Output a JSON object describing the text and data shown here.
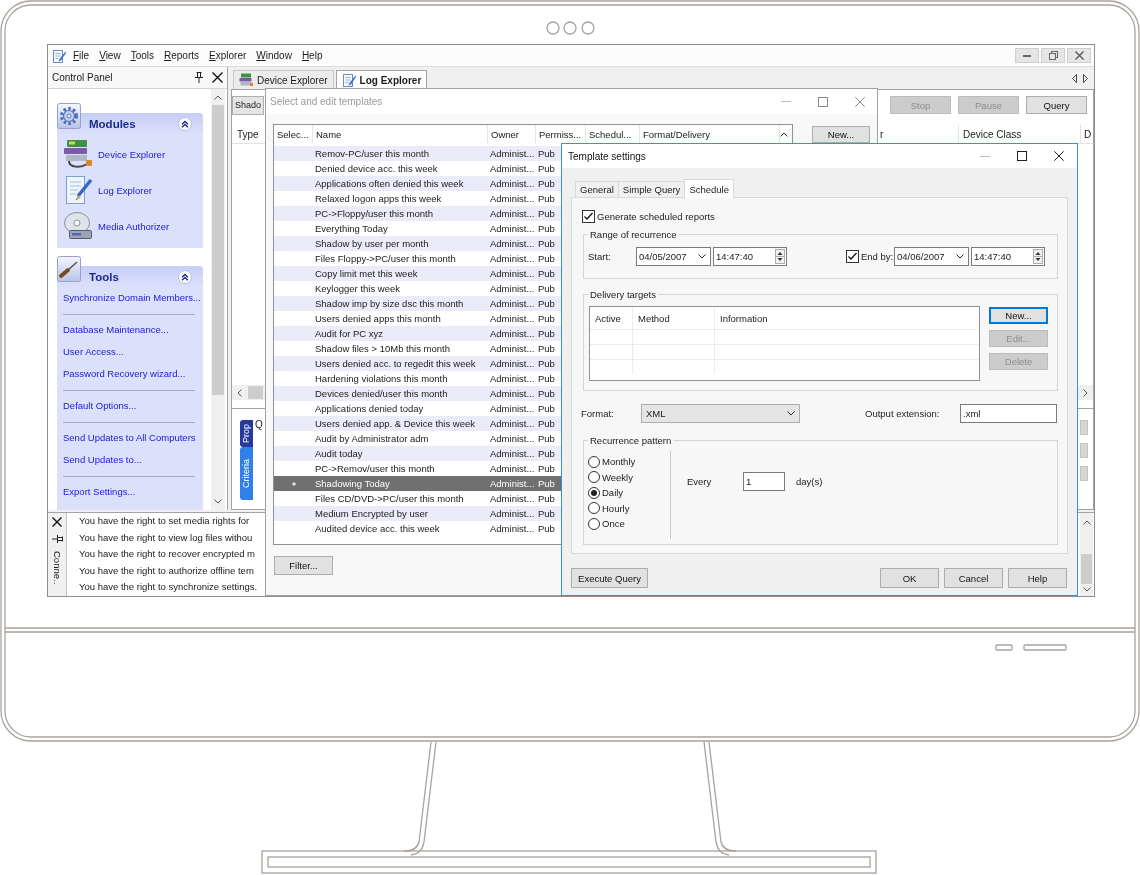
{
  "menu_bar": [
    "File",
    "View",
    "Tools",
    "Reports",
    "Explorer",
    "Window",
    "Help"
  ],
  "control_panel": {
    "title": "Control Panel",
    "groups": [
      {
        "title": "Modules",
        "expanded": true,
        "kind": "icons",
        "items": [
          "Device Explorer",
          "Log Explorer",
          "Media Authorizer"
        ]
      },
      {
        "title": "Tools",
        "expanded": true,
        "kind": "links",
        "sections": [
          [
            "Synchronize Domain Members..."
          ],
          [
            "Database Maintenance...",
            "User Access...",
            "Password Recovery wizard..."
          ],
          [
            "Default Options..."
          ],
          [
            "Send Updates to All Computers",
            "Send Updates to..."
          ],
          [
            "Export Settings..."
          ]
        ]
      }
    ]
  },
  "tabs": [
    {
      "label": "Device Explorer",
      "selected": false
    },
    {
      "label": "Log Explorer",
      "selected": true
    }
  ],
  "log_explorer": {
    "filter_value": "Shado",
    "buttons": [
      {
        "label": "Stop",
        "disabled": true
      },
      {
        "label": "Pause",
        "disabled": true
      },
      {
        "label": "Query",
        "disabled": false
      }
    ],
    "columns": [
      "Type",
      "r",
      "Device Class",
      "D"
    ],
    "side_tabs": [
      {
        "label": "Prop",
        "selected": false
      },
      {
        "label": "Criteria",
        "selected": true
      }
    ],
    "panel_heading": "Q"
  },
  "output_panel": {
    "title": "Conne..",
    "messages": [
      "You have the right to set media rights for",
      "You have the right to view log files withou",
      "You have the right to recover encrypted m",
      "You have the right to authorize offline tem",
      "You have the right to synchronize settings."
    ]
  },
  "templates_dialog": {
    "title": "Select and edit templates",
    "active": false,
    "columns": [
      "Selec...",
      "Name",
      "Owner",
      "Permiss...",
      "Schedul...",
      "Format/Delivery"
    ],
    "rows": [
      {
        "name": "Remov-PC/user this month",
        "owner": "Administ...",
        "permissions": "Pub",
        "selected": false
      },
      {
        "name": "Denied device acc. this week",
        "owner": "Administ...",
        "permissions": "Pub",
        "selected": false
      },
      {
        "name": "Applications often denied this week",
        "owner": "Administ...",
        "permissions": "Pub",
        "selected": false
      },
      {
        "name": "Relaxed logon apps this week",
        "owner": "Administ...",
        "permissions": "Pub",
        "selected": false
      },
      {
        "name": "PC->Floppy/user this month",
        "owner": "Administ...",
        "permissions": "Pub",
        "selected": false
      },
      {
        "name": "Everything Today",
        "owner": "Administ...",
        "permissions": "Pub",
        "selected": false
      },
      {
        "name": "Shadow by user per month",
        "owner": "Administ...",
        "permissions": "Pub",
        "selected": false
      },
      {
        "name": "Files Floppy->PC/user this month",
        "owner": "Administ...",
        "permissions": "Pub",
        "selected": false
      },
      {
        "name": "Copy limit met this week",
        "owner": "Administ...",
        "permissions": "Pub",
        "selected": false
      },
      {
        "name": "Keylogger this week",
        "owner": "Administ...",
        "permissions": "Pub",
        "selected": false
      },
      {
        "name": "Shadow imp by size dsc this month",
        "owner": "Administ...",
        "permissions": "Pub",
        "selected": false
      },
      {
        "name": "Users denied apps this month",
        "owner": "Administ...",
        "permissions": "Pub",
        "selected": false
      },
      {
        "name": "Audit for PC xyz",
        "owner": "Administ...",
        "permissions": "Pub",
        "selected": false
      },
      {
        "name": "Shadow files > 10Mb this month",
        "owner": "Administ...",
        "permissions": "Pub",
        "selected": false
      },
      {
        "name": "Users denied acc. to regedit this week",
        "owner": "Administ...",
        "permissions": "Pub",
        "selected": false
      },
      {
        "name": "Hardening violations this month",
        "owner": "Administ...",
        "permissions": "Pub",
        "selected": false
      },
      {
        "name": "Devices denied/user this month",
        "owner": "Administ...",
        "permissions": "Pub",
        "selected": false
      },
      {
        "name": "Applications denied today",
        "owner": "Administ...",
        "permissions": "Pub",
        "selected": false
      },
      {
        "name": "Users denied app. & Device this week",
        "owner": "Administ...",
        "permissions": "Pub",
        "selected": false
      },
      {
        "name": "Audit by Administrator adm",
        "owner": "Administ...",
        "permissions": "Pub",
        "selected": false
      },
      {
        "name": "Audit today",
        "owner": "Administ...",
        "permissions": "Pub",
        "selected": false
      },
      {
        "name": "PC->Remov/user this month",
        "owner": "Administ...",
        "permissions": "Pub",
        "selected": false
      },
      {
        "name": "Shadowing Today",
        "owner": "Administ...",
        "permissions": "Pub",
        "selected": true
      },
      {
        "name": "Files CD/DVD->PC/user this month",
        "owner": "Administ...",
        "permissions": "Pub",
        "selected": false
      },
      {
        "name": "Medium Encrypted by user",
        "owner": "Administ...",
        "permissions": "Pub",
        "selected": false
      },
      {
        "name": "Audited device acc. this week",
        "owner": "Administ...",
        "permissions": "Pub",
        "selected": false
      }
    ],
    "side_buttons": [
      "New..."
    ],
    "bottom_buttons": [
      "Filter..."
    ]
  },
  "settings_dialog": {
    "title": "Template settings",
    "active": true,
    "tabs": [
      {
        "label": "General",
        "selected": false
      },
      {
        "label": "Simple Query",
        "selected": false
      },
      {
        "label": "Schedule",
        "selected": true
      }
    ],
    "generate": {
      "label": "Generate scheduled reports",
      "checked": true
    },
    "range": {
      "title": "Range of recurrence",
      "start_label": "Start:",
      "start_date": "04/05/2007",
      "start_time": "14:47:40",
      "end_label": "End by:",
      "end_checked": true,
      "end_date": "04/06/2007",
      "end_time": "14:47:40"
    },
    "delivery": {
      "title": "Delivery targets",
      "columns": [
        "Active",
        "Method",
        "Information"
      ],
      "buttons": [
        {
          "label": "New...",
          "disabled": false,
          "focused": true
        },
        {
          "label": "Edit...",
          "disabled": true,
          "focused": false
        },
        {
          "label": "Delete",
          "disabled": true,
          "focused": false
        }
      ]
    },
    "format": {
      "label": "Format:",
      "value": "XML"
    },
    "extension": {
      "label": "Output extension:",
      "value": ".xml"
    },
    "recurrence": {
      "title": "Recurrence pattern",
      "options": [
        {
          "label": "Monthly",
          "selected": false
        },
        {
          "label": "Weekly",
          "selected": false
        },
        {
          "label": "Daily",
          "selected": true
        },
        {
          "label": "Hourly",
          "selected": false
        },
        {
          "label": "Once",
          "selected": false
        }
      ],
      "every_label": "Every",
      "every_value": "1",
      "unit": "day(s)"
    },
    "left_buttons": [
      "Execute Query"
    ],
    "right_buttons": [
      "OK",
      "Cancel",
      "Help"
    ]
  }
}
